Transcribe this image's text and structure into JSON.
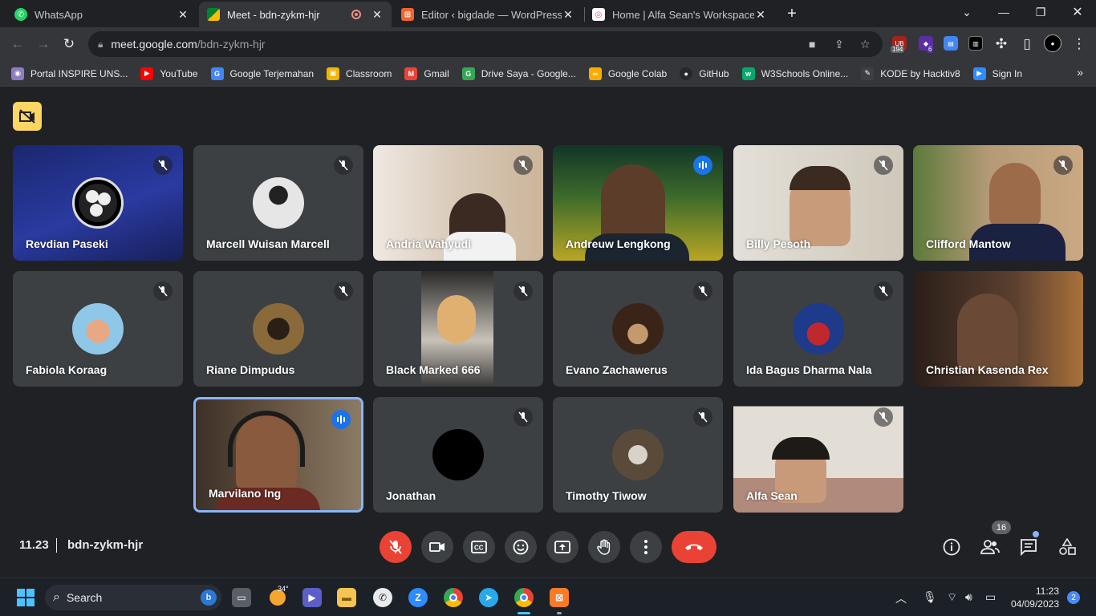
{
  "tabs": [
    {
      "title": "WhatsApp",
      "favicon": "whatsapp-icon",
      "color": "#25d366",
      "active": false
    },
    {
      "title": "Meet - bdn-zykm-hjr",
      "favicon": "meet-icon",
      "color": "#00897b",
      "active": true,
      "recording": true
    },
    {
      "title": "Editor ‹ bigdade — WordPress",
      "favicon": "wordpress-icon",
      "color": "#f0652f",
      "active": false
    },
    {
      "title": "Home | Alfa Sean's Workspace",
      "favicon": "workspace-icon",
      "color": "#ffffff",
      "active": false
    }
  ],
  "omnibox": {
    "host": "meet.google.com",
    "path": "/bdn-zykm-hjr"
  },
  "extensions": {
    "badge_1": "194",
    "badge_2": "6"
  },
  "bookmarks": [
    {
      "label": "Portal INSPIRE UNS...",
      "color": "#8e7cc3",
      "glyph": "◉"
    },
    {
      "label": "YouTube",
      "color": "#ff0000",
      "glyph": "▶"
    },
    {
      "label": "Google Terjemahan",
      "color": "#4285f4",
      "glyph": "G"
    },
    {
      "label": "Classroom",
      "color": "#f4b400",
      "glyph": "▣"
    },
    {
      "label": "Gmail",
      "color": "#ea4335",
      "glyph": "M"
    },
    {
      "label": "Drive Saya - Google...",
      "color": "#34a853",
      "glyph": "G"
    },
    {
      "label": "Google Colab",
      "color": "#f9ab00",
      "glyph": "∞"
    },
    {
      "label": "GitHub",
      "color": "#24292e",
      "glyph": "●"
    },
    {
      "label": "W3Schools Online...",
      "color": "#04aa6d",
      "glyph": "w"
    },
    {
      "label": "KODE by Hacktiv8",
      "color": "#ffffff",
      "glyph": "✎"
    },
    {
      "label": "Sign In",
      "color": "#2d8cff",
      "glyph": "▶"
    }
  ],
  "participants": [
    {
      "name": "Revdian Paseki",
      "state": "muted",
      "bg": "#1d2a6b",
      "avatar": "obs-logo"
    },
    {
      "name": "Marcell Wuisan Marcell",
      "state": "muted",
      "bg": "#3c4043",
      "avatar": "photo",
      "avatar_color": "#d8d8d8"
    },
    {
      "name": "Andria Wahyudi",
      "state": "muted",
      "bg": "#d9cbbd",
      "avatar": "video"
    },
    {
      "name": "Andreuw Lengkong",
      "state": "speaking",
      "bg": "#3b5a2a",
      "avatar": "video"
    },
    {
      "name": "Billy Pesoth",
      "state": "muted",
      "bg": "#d6d0c4",
      "avatar": "video"
    },
    {
      "name": "Clifford Mantow",
      "state": "muted",
      "bg": "#9a7a55",
      "avatar": "video"
    },
    {
      "name": "Fabiola Koraag",
      "state": "muted",
      "bg": "#3c4043",
      "avatar": "photo",
      "avatar_color": "#8fc7e8"
    },
    {
      "name": "Riane Dimpudus",
      "state": "muted",
      "bg": "#3c4043",
      "avatar": "photo",
      "avatar_color": "#8a6a3a"
    },
    {
      "name": "Black Marked 666",
      "state": "muted",
      "bg": "#3c4043",
      "avatar": "portrait"
    },
    {
      "name": "Evano Zachawerus",
      "state": "muted",
      "bg": "#3c4043",
      "avatar": "photo",
      "avatar_color": "#5a4030"
    },
    {
      "name": "Ida Bagus Dharma Nala",
      "state": "muted",
      "bg": "#3c4043",
      "avatar": "photo",
      "avatar_color": "#1e3a8a"
    },
    {
      "name": "Christian Kasenda Rex",
      "state": "video",
      "bg": "#4a3628",
      "avatar": "video"
    },
    {
      "name": "Marvilano Ing",
      "state": "speaking-active",
      "bg": "#5e4f3e",
      "avatar": "video"
    },
    {
      "name": "Jonathan",
      "state": "muted",
      "bg": "#3c4043",
      "avatar": "photo",
      "avatar_color": "#000000"
    },
    {
      "name": "Timothy Tiwow",
      "state": "muted",
      "bg": "#3c4043",
      "avatar": "photo",
      "avatar_color": "#6a5a4a"
    },
    {
      "name": "Alfa Sean",
      "state": "muted",
      "bg": "#dcd8d0",
      "avatar": "video"
    }
  ],
  "meeting": {
    "time": "11.23",
    "code": "bdn-zykm-hjr",
    "people_count": "16"
  },
  "controls": [
    "mic-off",
    "camera",
    "captions",
    "emoji",
    "present",
    "raise-hand",
    "more",
    "leave-call"
  ],
  "taskbar": {
    "search_placeholder": "Search",
    "weather": "34°",
    "clock_time": "11:23",
    "clock_date": "04/09/2023",
    "notifications": "2",
    "pinned": [
      "start",
      "search",
      "task-view",
      "weather",
      "zoom-meetings",
      "file-explorer",
      "whatsapp",
      "zoom",
      "chrome",
      "telegram",
      "chrome-active",
      "xampp"
    ]
  }
}
